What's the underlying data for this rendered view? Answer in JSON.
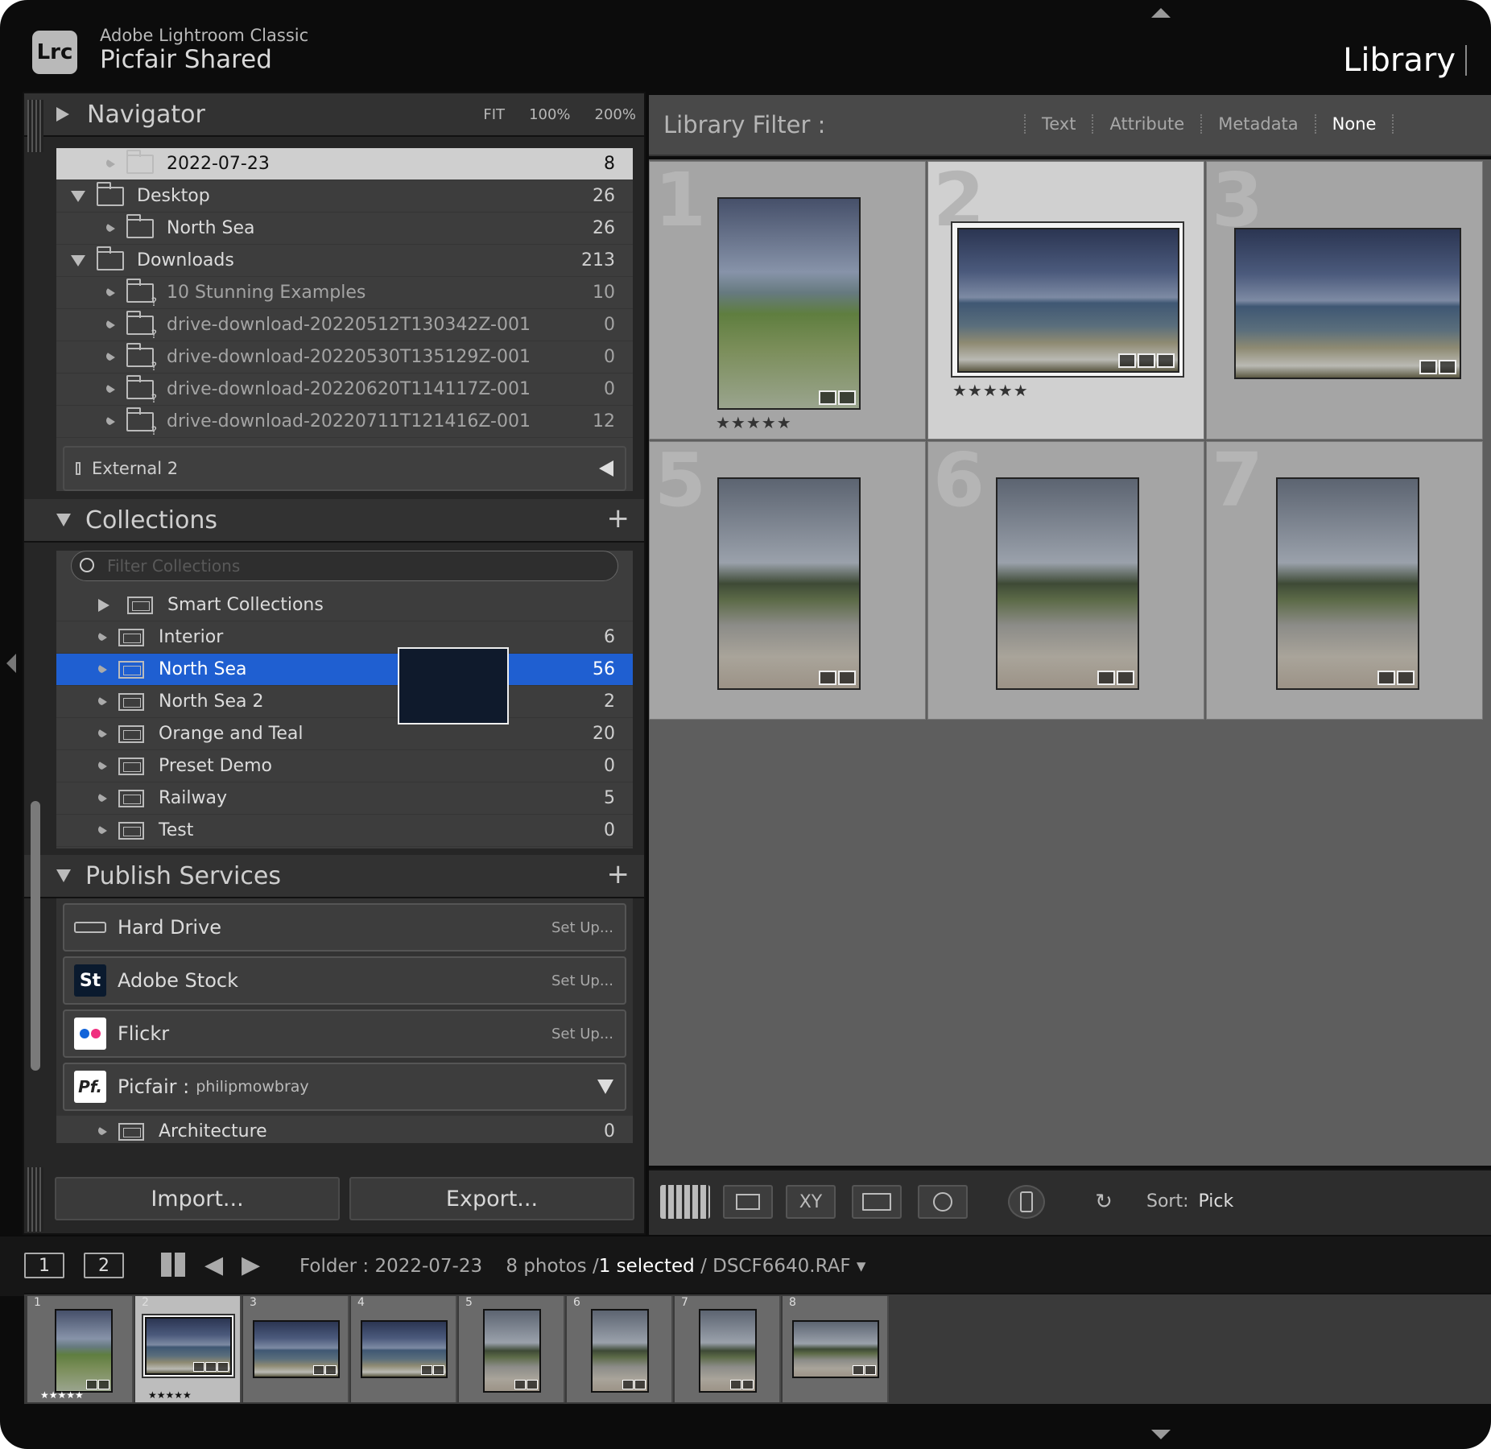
{
  "header": {
    "app_name": "Adobe Lightroom Classic",
    "catalog": "Picfair Shared",
    "logo": "Lrc",
    "module": "Library"
  },
  "navigator": {
    "title": "Navigator",
    "zoom": [
      "FIT",
      "100%",
      "200%"
    ]
  },
  "folders": [
    {
      "name": "2022-07-23",
      "count": "8",
      "level": 2,
      "selected": true
    },
    {
      "name": "Desktop",
      "count": "26",
      "level": 1,
      "expanded": true
    },
    {
      "name": "North Sea",
      "count": "26",
      "level": 2
    },
    {
      "name": "Downloads",
      "count": "213",
      "level": 1,
      "expanded": true
    },
    {
      "name": "10 Stunning Examples",
      "count": "10",
      "level": 2,
      "missing": true
    },
    {
      "name": "drive-download-20220512T130342Z-001",
      "count": "0",
      "level": 2,
      "missing": true
    },
    {
      "name": "drive-download-20220530T135129Z-001",
      "count": "0",
      "level": 2,
      "missing": true
    },
    {
      "name": "drive-download-20220620T114117Z-001",
      "count": "0",
      "level": 2,
      "missing": true
    },
    {
      "name": "drive-download-20220711T121416Z-001",
      "count": "12",
      "level": 2,
      "missing": true
    }
  ],
  "volume": {
    "name": "External 2"
  },
  "collections": {
    "title": "Collections",
    "search_placeholder": "Filter Collections",
    "items": [
      {
        "name": "Smart Collections",
        "count": ""
      },
      {
        "name": "Interior",
        "count": "6"
      },
      {
        "name": "North Sea",
        "count": "56",
        "selected": true
      },
      {
        "name": "North Sea 2",
        "count": "2"
      },
      {
        "name": "Orange and Teal",
        "count": "20"
      },
      {
        "name": "Preset Demo",
        "count": "0"
      },
      {
        "name": "Railway",
        "count": "5"
      },
      {
        "name": "Test",
        "count": "0"
      }
    ]
  },
  "publish": {
    "title": "Publish Services",
    "services": [
      {
        "name": "Hard Drive",
        "action": "Set Up..."
      },
      {
        "name": "Adobe Stock",
        "action": "Set Up...",
        "icon": "St"
      },
      {
        "name": "Flickr",
        "action": "Set Up..."
      },
      {
        "name": "Picfair :",
        "account": "philipmowbray",
        "icon": "Pf."
      }
    ],
    "sub_items": [
      {
        "name": "Architecture",
        "count": "0"
      }
    ]
  },
  "buttons": {
    "import": "Import...",
    "export": "Export..."
  },
  "filter": {
    "title": "Library Filter :",
    "options": [
      "Text",
      "Attribute",
      "Metadata",
      "None"
    ],
    "active": "None"
  },
  "grid": {
    "cells": [
      {
        "num": "1",
        "stars": "★★★★★"
      },
      {
        "num": "2",
        "stars": "★★★★★",
        "selected": true
      },
      {
        "num": "3",
        "stars": ""
      },
      {
        "num": "5",
        "stars": ""
      },
      {
        "num": "6",
        "stars": ""
      },
      {
        "num": "7",
        "stars": ""
      }
    ]
  },
  "toolbar": {
    "sort_label": "Sort:",
    "sort_value": "Pick",
    "xy": "XY"
  },
  "filmstrip": {
    "page1": "1",
    "page2": "2",
    "source": "Folder : 2022-07-23",
    "count": "8 photos /",
    "selected": "1 selected",
    "file": "/ DSCF6640.RAF",
    "items": [
      {
        "num": "1",
        "stars": "★★★★★"
      },
      {
        "num": "2",
        "stars": "★★★★★"
      },
      {
        "num": "3",
        "stars": ""
      },
      {
        "num": "4",
        "stars": ""
      },
      {
        "num": "5",
        "stars": ""
      },
      {
        "num": "6",
        "stars": ""
      },
      {
        "num": "7",
        "stars": ""
      },
      {
        "num": "8",
        "stars": ""
      }
    ]
  }
}
